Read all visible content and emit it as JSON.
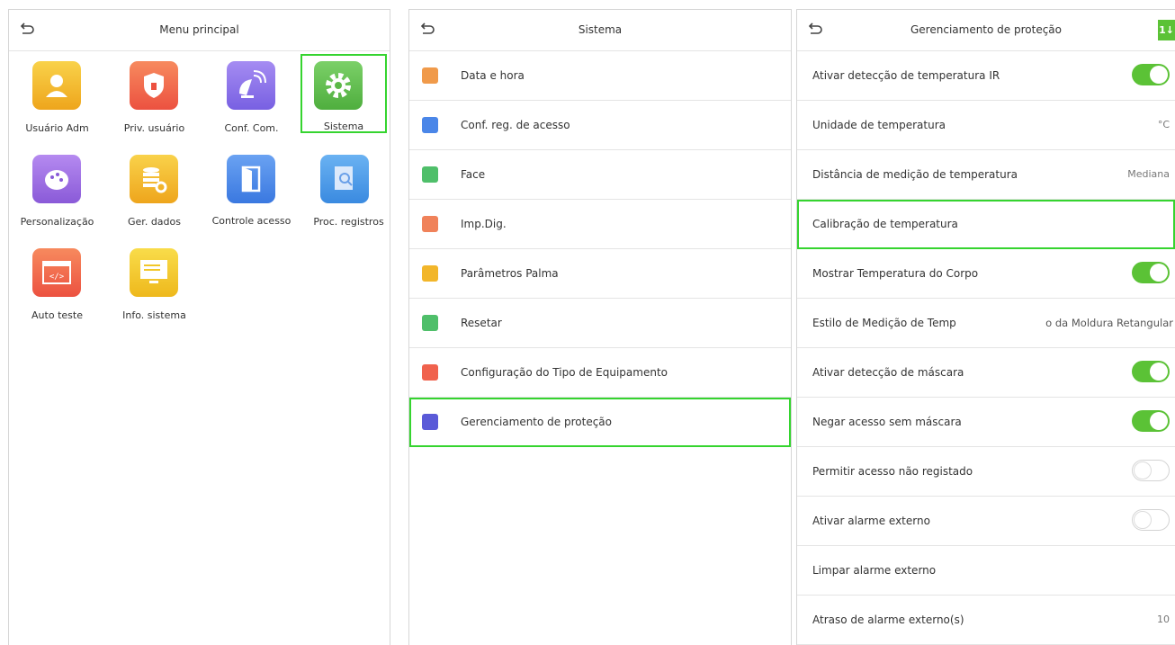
{
  "panel1": {
    "title": "Menu principal",
    "tiles": [
      {
        "label": "Usuário Adm",
        "icon": "admin-user-icon",
        "color": "#f2b62a"
      },
      {
        "label": "Priv. usuário",
        "icon": "shield-lock-icon",
        "color": "#f0624d"
      },
      {
        "label": "Conf. Com.",
        "icon": "satellite-dish-icon",
        "color": "#8a6ee8"
      },
      {
        "label": "Sistema",
        "icon": "gear-icon",
        "color": "#62bd4f"
      },
      {
        "label": "Personalização",
        "icon": "palette-icon",
        "color": "#9a6ae0"
      },
      {
        "label": "Ger. dados",
        "icon": "database-gear-icon",
        "color": "#f2b62a"
      },
      {
        "label": "Controle acesso",
        "icon": "door-icon",
        "color": "#4a86e8"
      },
      {
        "label": "Proc. registros",
        "icon": "search-document-icon",
        "color": "#4a9be8"
      },
      {
        "label": "Auto teste",
        "icon": "code-window-icon",
        "color": "#f0624d"
      },
      {
        "label": "Info. sistema",
        "icon": "monitor-icon",
        "color": "#f2c72a"
      }
    ]
  },
  "panel2": {
    "title": "Sistema",
    "items": [
      {
        "label": "Data e hora",
        "icon": "clock-icon",
        "color": "#f09a4a"
      },
      {
        "label": "Conf. reg. de acesso",
        "icon": "record-settings-icon",
        "color": "#4a86e8"
      },
      {
        "label": "Face",
        "icon": "face-icon",
        "color": "#4fbf6a"
      },
      {
        "label": "Imp.Dig.",
        "icon": "fingerprint-icon",
        "color": "#f0825a"
      },
      {
        "label": "Parâmetros Palma",
        "icon": "palm-icon",
        "color": "#f2b62a"
      },
      {
        "label": "Resetar",
        "icon": "reset-icon",
        "color": "#4fbf6a"
      },
      {
        "label": "Configuração do Tipo de Equipamento",
        "icon": "device-type-icon",
        "color": "#f0624d"
      },
      {
        "label": "Gerenciamento de proteção",
        "icon": "protection-shield-icon",
        "color": "#5a5ad8"
      }
    ]
  },
  "panel3": {
    "title": "Gerenciamento de proteção",
    "corner_label": "1↓",
    "rows": [
      {
        "label": "Ativar detecção de temperatura IR",
        "toggle": "on"
      },
      {
        "label": "Unidade de temperatura",
        "value": "°C"
      },
      {
        "label": "Distância de medição de temperatura",
        "value": "Mediana"
      },
      {
        "label": "Calibração de temperatura"
      },
      {
        "label": "Mostrar Temperatura do Corpo",
        "toggle": "on"
      },
      {
        "label": "Estilo de Medição de Temp",
        "value": "o da Moldura Retangular"
      },
      {
        "label": "Ativar detecção de máscara",
        "toggle": "on"
      },
      {
        "label": "Negar acesso sem máscara",
        "toggle": "on"
      },
      {
        "label": "Permitir acesso não registado",
        "toggle": "off"
      },
      {
        "label": "Ativar alarme externo",
        "toggle": "off"
      },
      {
        "label": "Limpar alarme externo"
      },
      {
        "label": "Atraso de alarme externo(s)",
        "value": "10"
      }
    ]
  },
  "colors": {
    "highlight": "#35d42f",
    "toggle_on": "#5bc236"
  }
}
